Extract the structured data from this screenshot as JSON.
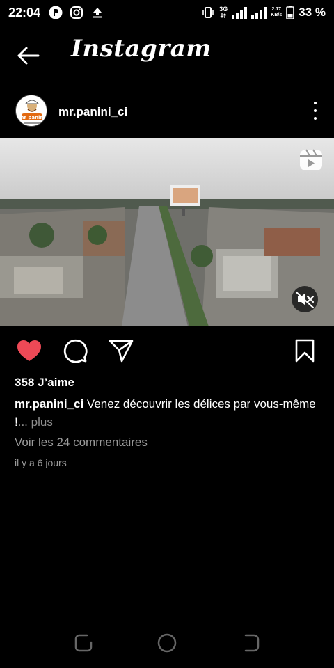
{
  "status_bar": {
    "time": "22:04",
    "network_type": "3G",
    "speed_value": "2.17",
    "speed_unit": "KB/s",
    "battery_percent": "33 %"
  },
  "header": {
    "app_title": "Instagram"
  },
  "post": {
    "username": "mr.panini_ci",
    "avatar_text": "mr panini",
    "likes": "358 J’aime",
    "caption_user": "mr.panini_ci",
    "caption_text": " Venez découvrir les délices par vous-même !",
    "caption_more": "... plus",
    "comments_link": "Voir les 24 commentaires",
    "time_ago": "il y a 6 jours",
    "liked": true
  },
  "colors": {
    "like_red": "#ed4956",
    "secondary_text": "#9a9a9a",
    "background": "#000000"
  }
}
